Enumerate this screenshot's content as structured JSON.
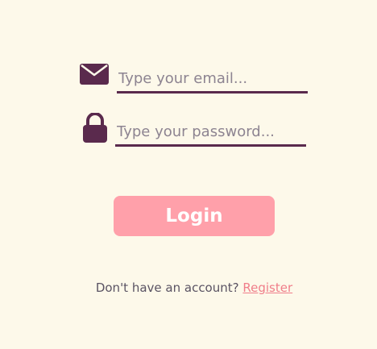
{
  "colors": {
    "background": "#fdf9ea",
    "accent": "#5a2a4d",
    "button": "#ffa0aa",
    "link": "#f07e8a"
  },
  "form": {
    "email": {
      "icon": "envelope-icon",
      "value": "",
      "placeholder": "Type your email..."
    },
    "password": {
      "icon": "lock-icon",
      "value": "",
      "placeholder": "Type your password..."
    },
    "login_label": "Login"
  },
  "footer": {
    "prompt": "Don't have an account?",
    "register_label": "Register"
  }
}
